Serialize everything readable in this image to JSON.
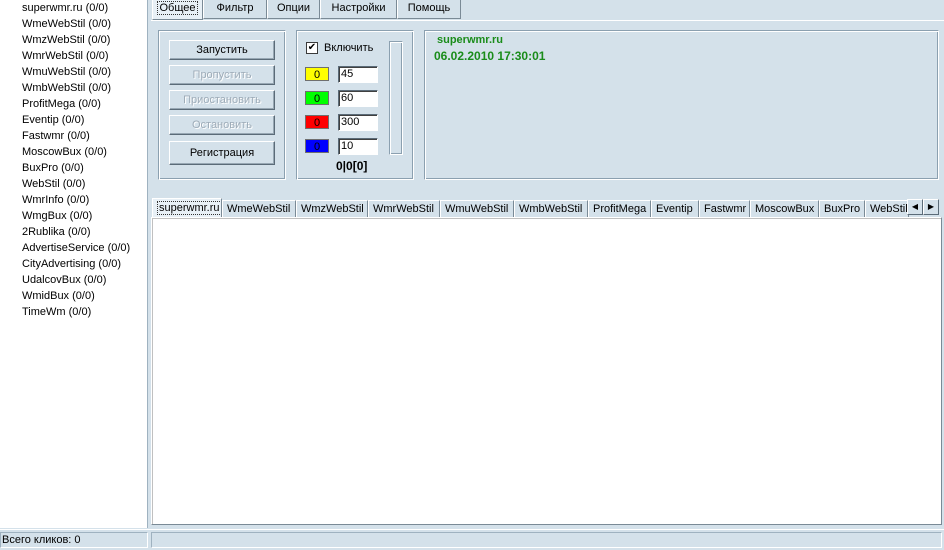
{
  "sites": [
    "superwmr.ru (0/0)",
    "WmeWebStil (0/0)",
    "WmzWebStil (0/0)",
    "WmrWebStil (0/0)",
    "WmuWebStil (0/0)",
    "WmbWebStil (0/0)",
    "ProfitMega (0/0)",
    "Eventip (0/0)",
    "Fastwmr (0/0)",
    "MoscowBux (0/0)",
    "BuxPro (0/0)",
    "WebStil (0/0)",
    "WmrInfo (0/0)",
    "WmgBux (0/0)",
    "2Rublika (0/0)",
    "AdvertiseService (0/0)",
    "CityAdvertising (0/0)",
    "UdalcovBux (0/0)",
    "WmidBux (0/0)",
    "TimeWm (0/0)"
  ],
  "status": {
    "clicks": "Всего кликов: 0"
  },
  "top_tabs": [
    "Общее",
    "Фильтр",
    "Опции",
    "Настройки",
    "Помощь"
  ],
  "buttons": {
    "start": "Запустить",
    "skip": "Пропустить",
    "pause": "Приостановить",
    "stop": "Остановить",
    "register": "Регистрация"
  },
  "enable": {
    "label": "Включить",
    "checked": true,
    "check_glyph": "✔"
  },
  "timers": [
    {
      "count": "0",
      "value": "45",
      "color": "#ffff00"
    },
    {
      "count": "0",
      "value": "60",
      "color": "#00ff00"
    },
    {
      "count": "0",
      "value": "300",
      "color": "#ff0000"
    },
    {
      "count": "0",
      "value": "10",
      "color": "#0000ff"
    }
  ],
  "counter_summary": "0|0[0]",
  "info": {
    "site": "superwmr.ru",
    "datetime": "06.02.2010 17:30:01",
    "color": "#1a8c1a"
  },
  "site_tabs": [
    "superwmr.ru",
    "WmeWebStil",
    "WmzWebStil",
    "WmrWebStil",
    "WmuWebStil",
    "WmbWebStil",
    "ProfitMega",
    "Eventip",
    "Fastwmr",
    "MoscowBux",
    "BuxPro",
    "WebStil"
  ],
  "scroll_left_glyph": "◀",
  "scroll_right_glyph": "▶"
}
